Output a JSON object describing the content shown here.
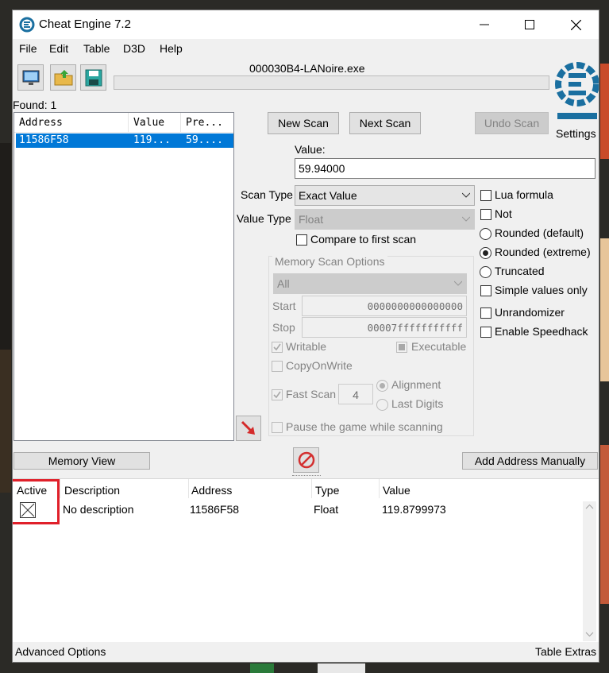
{
  "window": {
    "title": "Cheat Engine 7.2"
  },
  "menu": [
    "File",
    "Edit",
    "Table",
    "D3D",
    "Help"
  ],
  "process": {
    "name": "000030B4-LANoire.exe"
  },
  "found": {
    "label": "Found: 1"
  },
  "address_list": {
    "columns": [
      "Address",
      "Value",
      "Pre..."
    ],
    "rows": [
      {
        "address": "11586F58",
        "value": "119...",
        "previous": "59...."
      }
    ]
  },
  "scan": {
    "new_scan": "New Scan",
    "next_scan": "Next Scan",
    "undo_scan": "Undo Scan",
    "settings": "Settings",
    "value_label": "Value:",
    "value": "59.94000",
    "scan_type_label": "Scan Type",
    "scan_type": "Exact Value",
    "value_type_label": "Value Type",
    "value_type": "Float",
    "compare_first": "Compare to first scan"
  },
  "options": {
    "lua_formula": "Lua formula",
    "not": "Not",
    "rounded_default": "Rounded (default)",
    "rounded_extreme": "Rounded (extreme)",
    "truncated": "Truncated",
    "simple_values": "Simple values only",
    "unrandomizer": "Unrandomizer",
    "speedhack": "Enable Speedhack"
  },
  "memory_scan": {
    "title": "Memory Scan Options",
    "region": "All",
    "start_label": "Start",
    "start": "0000000000000000",
    "stop_label": "Stop",
    "stop": "00007fffffffffff",
    "writable": "Writable",
    "executable": "Executable",
    "copy_on_write": "CopyOnWrite",
    "fast_scan": "Fast Scan",
    "fast_scan_value": "4",
    "alignment": "Alignment",
    "last_digits": "Last Digits",
    "pause_game": "Pause the game while scanning"
  },
  "buttons": {
    "memory_view": "Memory View",
    "add_address": "Add Address Manually"
  },
  "cheat_table": {
    "columns": [
      "Active",
      "Description",
      "Address",
      "Type",
      "Value"
    ],
    "rows": [
      {
        "description": "No description",
        "address": "11586F58",
        "type": "Float",
        "value": "119.8799973"
      }
    ]
  },
  "status": {
    "advanced": "Advanced Options",
    "extras": "Table Extras"
  },
  "colors": {
    "selection": "#0078d7",
    "highlight_box": "#e0202a",
    "arrow": "#d42a2a",
    "stop_icon": "#d32f2f",
    "logo": "#1a6fa0"
  }
}
